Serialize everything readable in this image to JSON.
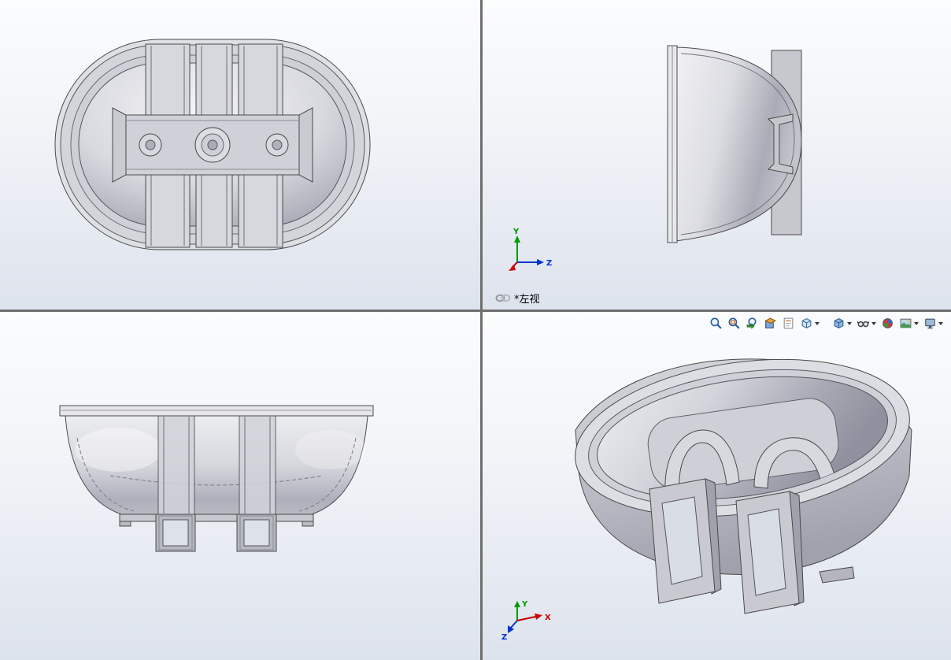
{
  "app": {
    "kind": "cad-four-viewport-window"
  },
  "viewports": {
    "top_left": {
      "content": "top-view-of-part"
    },
    "top_right": {
      "label": "*左视",
      "axes": {
        "y": "Y",
        "z": "Z"
      }
    },
    "bottom_left": {
      "content": "front-view-of-part"
    },
    "bottom_right": {
      "content": "isometric-view-of-part",
      "axes": {
        "x": "X",
        "y": "Y",
        "z": "Z"
      }
    }
  },
  "toolbar": {
    "items": [
      {
        "name": "zoom-to-fit"
      },
      {
        "name": "zoom-to-area"
      },
      {
        "name": "previous-view"
      },
      {
        "name": "section-view"
      },
      {
        "name": "dynamic-annotation-views"
      },
      {
        "name": "view-orientation",
        "dropdown": true
      },
      {
        "name": "display-style",
        "dropdown": true
      },
      {
        "name": "hide-show-items",
        "dropdown": true
      },
      {
        "name": "edit-appearance"
      },
      {
        "name": "apply-scene",
        "dropdown": true
      },
      {
        "name": "view-settings",
        "dropdown": true
      }
    ]
  },
  "colors": {
    "axis_x": "#cc0000",
    "axis_y": "#009900",
    "axis_z": "#0033cc",
    "divider": "#6e6e6e",
    "edge": "#4a4a4a",
    "part_light": "#ecedf0",
    "part_dark": "#9fa1ad"
  }
}
